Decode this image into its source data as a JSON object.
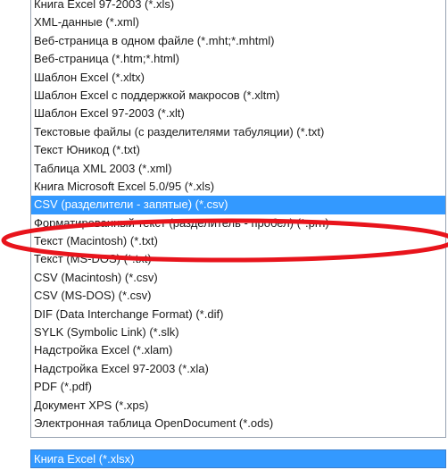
{
  "dropdown": {
    "items": [
      {
        "label": "Книга Excel 97-2003 (*.xls)"
      },
      {
        "label": "XML-данные (*.xml)"
      },
      {
        "label": "Веб-страница в одном файле (*.mht;*.mhtml)"
      },
      {
        "label": "Веб-страница (*.htm;*.html)"
      },
      {
        "label": "Шаблон Excel (*.xltx)"
      },
      {
        "label": "Шаблон Excel с поддержкой макросов (*.xltm)"
      },
      {
        "label": "Шаблон Excel 97-2003 (*.xlt)"
      },
      {
        "label": "Текстовые файлы (с разделителями табуляции) (*.txt)"
      },
      {
        "label": "Текст Юникод (*.txt)"
      },
      {
        "label": "Таблица XML 2003 (*.xml)"
      },
      {
        "label": "Книга Microsoft Excel 5.0/95 (*.xls)"
      },
      {
        "label": "CSV (разделители - запятые) (*.csv)",
        "selected": true
      },
      {
        "label": "Форматированный текст (разделитель - пробел) (*.prn)"
      },
      {
        "label": "Текст (Macintosh) (*.txt)"
      },
      {
        "label": "Текст (MS-DOS) (*.txt)"
      },
      {
        "label": "CSV (Macintosh) (*.csv)"
      },
      {
        "label": "CSV (MS-DOS) (*.csv)"
      },
      {
        "label": "DIF (Data Interchange Format) (*.dif)"
      },
      {
        "label": "SYLK (Symbolic Link) (*.slk)"
      },
      {
        "label": "Надстройка Excel (*.xlam)"
      },
      {
        "label": "Надстройка Excel 97-2003 (*.xla)"
      },
      {
        "label": "PDF (*.pdf)"
      },
      {
        "label": "Документ XPS (*.xps)"
      },
      {
        "label": "Электронная таблица OpenDocument (*.ods)"
      }
    ]
  },
  "combo": {
    "value": "Книга Excel (*.xlsx)"
  },
  "colors": {
    "selection": "#3399ff",
    "annotation": "#e8141c"
  }
}
